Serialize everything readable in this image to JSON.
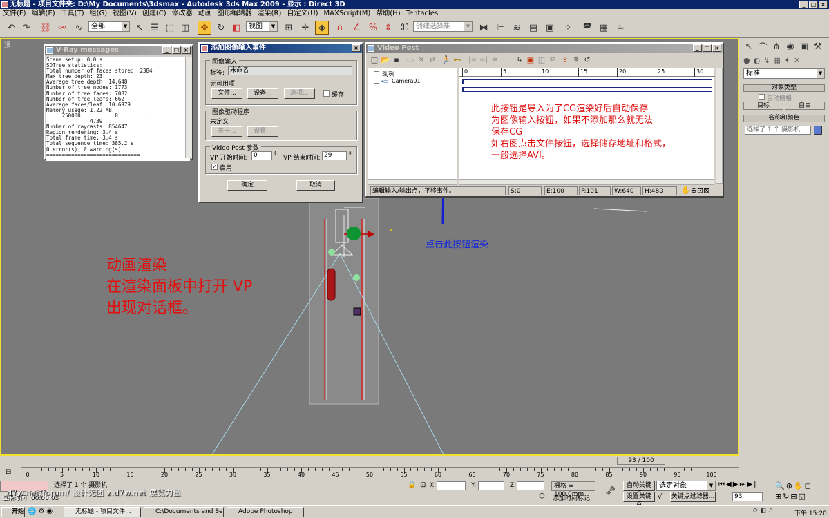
{
  "app": {
    "title": "无标题   - 项目文件夹: D:\\My Documents\\3dsmax   - Autodesk 3ds Max  2009    - 显示 : Direct 3D",
    "menu": [
      "文件(F)",
      "编辑(E)",
      "工具(T)",
      "组(G)",
      "视图(V)",
      "创建(C)",
      "修改器",
      "动画",
      "图形编辑器",
      "渲染(R)",
      "自定义(U)",
      "MAXScript(M)",
      "帮助(H)",
      "Tentacles"
    ]
  },
  "toolbar": {
    "filter_value": "全部",
    "coord_value": "视图",
    "selset_placeholder": "创建选择集"
  },
  "viewport": {
    "label": "顶"
  },
  "vray": {
    "title": "V-Ray messages",
    "log": "Scene setup: 0.0 s\nSDTree statistics:\nTotal number of faces stored: 2384\nMax tree depth: 23\nAverage tree depth: 14.648\nNumber of tree nodes: 1773\nNumber of tree faces: 7082\nNumber of tree leafs: 662\nAverage faces/leaf: 10.6979\nMemory usage: 1.22 MB\n     250000           8          .\n              4739\nNumber of raycasts: 854647\nRegion rendering: 3.4 s\nTotal frame time: 3.4 s\nTotal sequence time: 385.2 s\n0 error(s), 0 warning(s)\n=============================="
  },
  "dialog": {
    "title": "添加图像输入事件",
    "image_input": "图像输入",
    "label_caption": "标签:",
    "label_value": "未命名",
    "unavailable": "无可用项",
    "files_btn": "文件...",
    "devices_btn": "设备...",
    "options_btn": "选项...",
    "cache_label": "缓存",
    "driver_group": "图像驱动程序",
    "undefined": "未定义",
    "about_btn": "关于...",
    "setup_btn": "设置...",
    "params_group": "Video Post 参数",
    "vp_start_label": "VP 开始时间:",
    "vp_start_value": "0",
    "vp_end_label": "VP 结束时间:",
    "vp_end_value": "29",
    "enable_label": "启用",
    "ok_btn": "确定",
    "cancel_btn": "取消"
  },
  "videopost": {
    "title": "Video Post",
    "queue_label": "队列",
    "camera_label": "Camera01",
    "ruler": [
      "0",
      "5",
      "10",
      "15",
      "20",
      "25",
      "30"
    ],
    "status_text": "编辑输入/输出点，平移事件。",
    "s": "S:0",
    "e": "E:100",
    "f": "F:101",
    "w": "W:640",
    "h": "H:480"
  },
  "annotations": {
    "blue_hint": "点击此按钮渲染",
    "red_note": [
      "此按钮是导入为了CG渲染好后自动保存",
      "为图像输入按钮，如果不添加那么就无法",
      "保存CG",
      "如右图点击文件按钮，选择储存地址和格式，",
      "一般选择AVI。"
    ],
    "big_note": [
      "动画渲染",
      "在渲染面板中打开 VP",
      "出现对话框。"
    ]
  },
  "cmdpanel": {
    "dropdown": "标准",
    "object_type": "对象类型",
    "auto_grid": "自动栅格",
    "target_btn": "目标",
    "free_btn": "自由",
    "name_color": "名称和颜色",
    "name_field": "选择了 1 个 摄影机"
  },
  "timeline": {
    "slider": "93 / 100",
    "ticks": [
      "0",
      "5",
      "10",
      "15",
      "20",
      "25",
      "30",
      "35",
      "40",
      "45",
      "50",
      "55",
      "60",
      "65",
      "70",
      "75",
      "80",
      "85",
      "90",
      "95",
      "100"
    ]
  },
  "status": {
    "selection": "选择了 1 个 摄影机",
    "x_label": "X:",
    "y_label": "Y:",
    "z_label": "Z:",
    "grid": "栅格 = 100.0mm",
    "auto_key": "自动关键点",
    "set_key": "设置关键点",
    "selected_obj": "选定对象",
    "key_filters": "关键点过滤器...",
    "add_time_tag": "添加时间标记",
    "frame": "93",
    "watermark": "d7w.net/forum/ 设计无团 z.d7w.net 展览力量",
    "render_time": "渲染时间: 00:00:03"
  },
  "taskbar": {
    "start": "开始",
    "tasks": [
      "无标题      - 项目文件...",
      "C:\\Documents and Settin...",
      "Adobe Photoshop"
    ],
    "clock": "下午 15:20"
  }
}
